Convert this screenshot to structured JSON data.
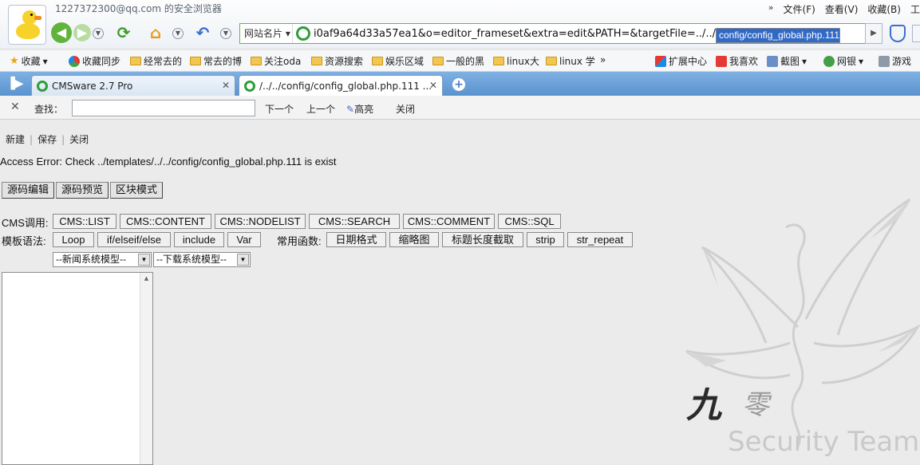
{
  "browser": {
    "account": "1227372300@qq.com 的安全浏览器",
    "menu": [
      "文件(F)",
      "查看(V)",
      "收藏(B)",
      "工"
    ],
    "address": {
      "site_label": "网站名片",
      "url_prefix": "i0af9a64d33a57ea1&o=editor_frameset&extra=edit&PATH=&targetFile=../../",
      "url_selected": "config/config_global.php.111"
    },
    "favorites": {
      "left": [
        "收藏",
        "收藏同步",
        "经常去的",
        "常去的博",
        "关注oda",
        "资源搜索",
        "娱乐区域",
        "一般的黑",
        "linux大",
        "linux 学"
      ],
      "right": [
        "扩展中心",
        "我喜欢",
        "截图",
        "网银",
        "游戏"
      ]
    },
    "tabs": [
      {
        "label": "CMSware 2.7 Pro"
      },
      {
        "label": "/../../config/config_global.php.111 ..."
      }
    ],
    "findbar": {
      "label": "查找：",
      "next": "下一个",
      "prev": "上一个",
      "highlight": "高亮",
      "close": "关闭"
    }
  },
  "page": {
    "links": [
      "新建",
      "保存",
      "关闭"
    ],
    "error": "Access Error: Check ../templates/../../config/config_global.php.111 is exist",
    "mode_tabs": [
      "源码编辑",
      "源码预览",
      "区块模式"
    ],
    "cms_label": "CMS调用:",
    "cms_buttons": [
      "CMS::LIST",
      "CMS::CONTENT",
      "CMS::NODELIST",
      "CMS::SEARCH",
      "CMS::COMMENT",
      "CMS::SQL"
    ],
    "syntax_label": "模板语法:",
    "syntax_buttons": [
      "Loop",
      "if/elseif/else",
      "include",
      "Var"
    ],
    "func_label": "常用函数:",
    "func_buttons": [
      "日期格式",
      "缩略图",
      "标题长度截取",
      "strip",
      "str_repeat"
    ],
    "selects": [
      "--新闻系统模型--",
      "--下载系统模型--"
    ]
  }
}
